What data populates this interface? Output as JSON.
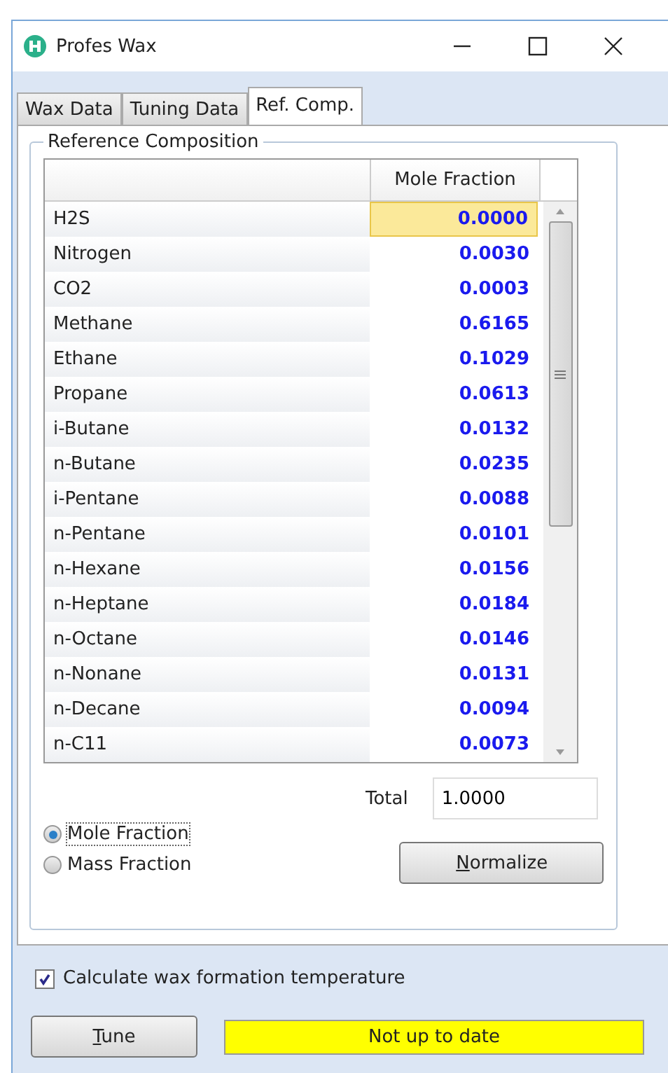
{
  "window": {
    "title": "Profes Wax"
  },
  "tabs": [
    {
      "label": "Wax Data",
      "selected": false
    },
    {
      "label": "Tuning Data",
      "selected": false
    },
    {
      "label": "Ref. Comp.",
      "selected": true
    }
  ],
  "group": {
    "title": "Reference Composition"
  },
  "table": {
    "columns": [
      "Mole Fraction"
    ],
    "rows": [
      {
        "name": "H2S",
        "value": "0.0000",
        "selected": true
      },
      {
        "name": "Nitrogen",
        "value": "0.0030",
        "selected": false
      },
      {
        "name": "CO2",
        "value": "0.0003",
        "selected": false
      },
      {
        "name": "Methane",
        "value": "0.6165",
        "selected": false
      },
      {
        "name": "Ethane",
        "value": "0.1029",
        "selected": false
      },
      {
        "name": "Propane",
        "value": "0.0613",
        "selected": false
      },
      {
        "name": "i-Butane",
        "value": "0.0132",
        "selected": false
      },
      {
        "name": "n-Butane",
        "value": "0.0235",
        "selected": false
      },
      {
        "name": "i-Pentane",
        "value": "0.0088",
        "selected": false
      },
      {
        "name": "n-Pentane",
        "value": "0.0101",
        "selected": false
      },
      {
        "name": "n-Hexane",
        "value": "0.0156",
        "selected": false
      },
      {
        "name": "n-Heptane",
        "value": "0.0184",
        "selected": false
      },
      {
        "name": "n-Octane",
        "value": "0.0146",
        "selected": false
      },
      {
        "name": "n-Nonane",
        "value": "0.0131",
        "selected": false
      },
      {
        "name": "n-Decane",
        "value": "0.0094",
        "selected": false
      },
      {
        "name": "n-C11",
        "value": "0.0073",
        "selected": false
      }
    ]
  },
  "total": {
    "label": "Total",
    "value": "1.0000"
  },
  "basis": [
    {
      "label": "Mole Fraction",
      "selected": true
    },
    {
      "label": "Mass Fraction",
      "selected": false
    }
  ],
  "normalize_button": {
    "label": "Normalize",
    "mnemonic_first": true
  },
  "calc_checkbox": {
    "label": "Calculate wax formation temperature",
    "checked": true
  },
  "tune_button": {
    "label": "Tune",
    "mnemonic_first": true
  },
  "status": {
    "text": "Not up to date"
  }
}
